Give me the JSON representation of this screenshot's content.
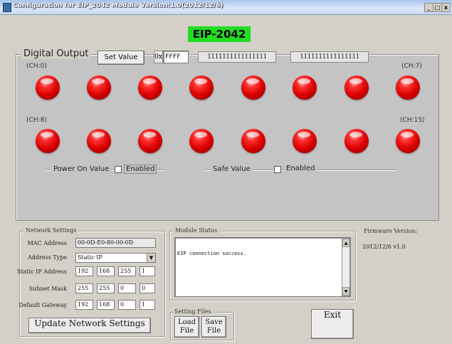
{
  "window": {
    "title": "Configuration for EIP_2042 Module Version:1.0(2012/12/6)",
    "controls": [
      "_",
      "□",
      "x"
    ]
  },
  "header": {
    "badge": "EIP-2042",
    "badge_color": "#22dd22"
  },
  "digital_output": {
    "title": "Digital Output",
    "set_value_label": "Set Value",
    "hex_prefix": "0x",
    "hex_value": "FFFF",
    "bits_high": "1111111111111111",
    "bits_low": "1111111111111111",
    "row1_first": "(CH:0)",
    "row1_last": "(CH:7)",
    "row2_first": "(CH:8)",
    "row2_last": "(CH:15)",
    "channels_on": [
      true,
      true,
      true,
      true,
      true,
      true,
      true,
      true,
      true,
      true,
      true,
      true,
      true,
      true,
      true,
      true
    ],
    "led_color": "#e00000",
    "power_on": {
      "label": "Power On Value",
      "checkbox_label": "Enabled",
      "checked": false
    },
    "safe_value": {
      "label": "Safe Value",
      "checkbox_label": "Enabled",
      "checked": false
    }
  },
  "network": {
    "group_label": "Network Settings",
    "mac_label": "MAC Address",
    "mac_value": "00-0D-E0-80-00-0D",
    "addr_type_label": "Address Type",
    "addr_type_value": "Static IP",
    "static_ip_label": "Static IP Address",
    "static_ip": [
      "192",
      "168",
      "255",
      "1"
    ],
    "subnet_label": "Subnet Mask",
    "subnet": [
      "255",
      "255",
      "0",
      "0"
    ],
    "gateway_label": "Default Gateway",
    "gateway": [
      "192",
      "168",
      "0",
      "1"
    ],
    "update_button": "Update Network Settings"
  },
  "status": {
    "group_label": "Module Status",
    "text": "EIP connection success."
  },
  "firmware": {
    "label": "Firmware Version:",
    "value": "2012/12/6 v1.0"
  },
  "setting_files": {
    "group_label": "Setting Files",
    "load_line1": "Load",
    "load_line2": "File",
    "save_line1": "Save",
    "save_line2": "File"
  },
  "exit_label": "Exit"
}
